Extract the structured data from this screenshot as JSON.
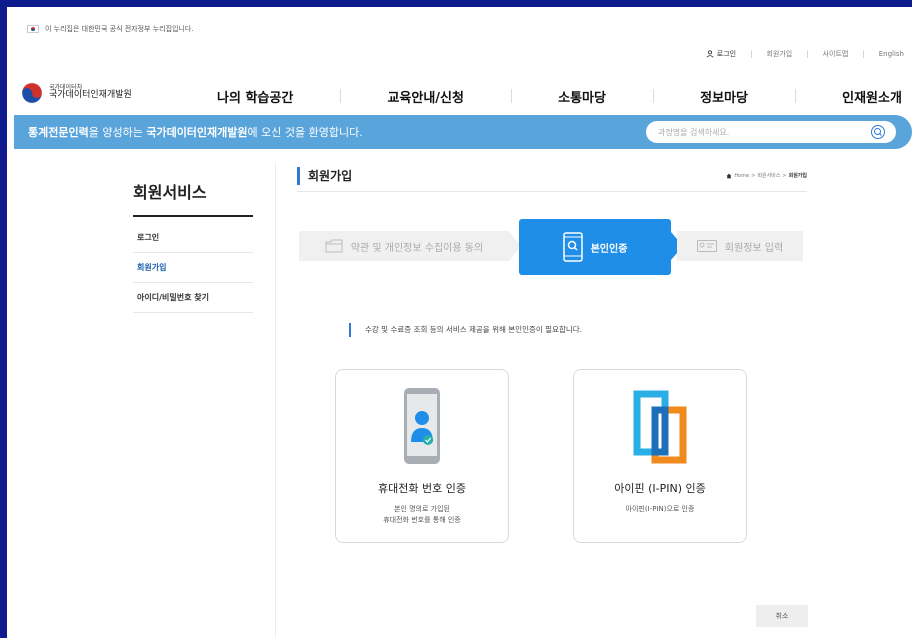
{
  "gov_banner": {
    "text": "이 누리집은 대한민국 공식 전자정부 누리집입니다."
  },
  "utility": {
    "login": "로그인",
    "signup": "회원가입",
    "sitemap": "사이트맵",
    "english": "English"
  },
  "logo": {
    "line1": "국가데이터처",
    "line2": "국가데이터인재개발원"
  },
  "gnb": [
    "나의 학습공간",
    "교육안내/신청",
    "소통마당",
    "정보마당",
    "인재원소개"
  ],
  "welcome": {
    "part1": "통계전문인력",
    "part2": "을 양성하는 ",
    "part3": "국가데이터인재개발원",
    "part4": "에 오신 것을 환영합니다."
  },
  "search": {
    "placeholder": "과정명을 검색하세요."
  },
  "lnb": {
    "title": "회원서비스",
    "items": [
      "로그인",
      "회원가입",
      "아이디/비밀번호 찾기"
    ]
  },
  "page": {
    "title": "회원가입",
    "breadcrumb": {
      "home": "Home",
      "sep": ">",
      "level1": "회원서비스",
      "current": "회원가입"
    }
  },
  "steps": [
    "약관 및 개인정보 수집이용 동의",
    "본인인증",
    "회원정보 입력"
  ],
  "notice": "수강 및 수료증 조회 등의 서비스 제공을 위해 본인인증이 필요합니다.",
  "cards": [
    {
      "title": "휴대전화 번호 인증",
      "desc": "본인 명의로 가입된\n휴대전화 번호를 통해 인증"
    },
    {
      "title": "아이핀 (I-PIN) 인증",
      "desc": "아이핀(I-PIN)으로 인증"
    }
  ],
  "cancel": "취소",
  "colors": {
    "frame": "#0d1b8f",
    "banner": "#5aa4dc",
    "active_step": "#1e8ee8",
    "accent": "#2f7bd1"
  }
}
